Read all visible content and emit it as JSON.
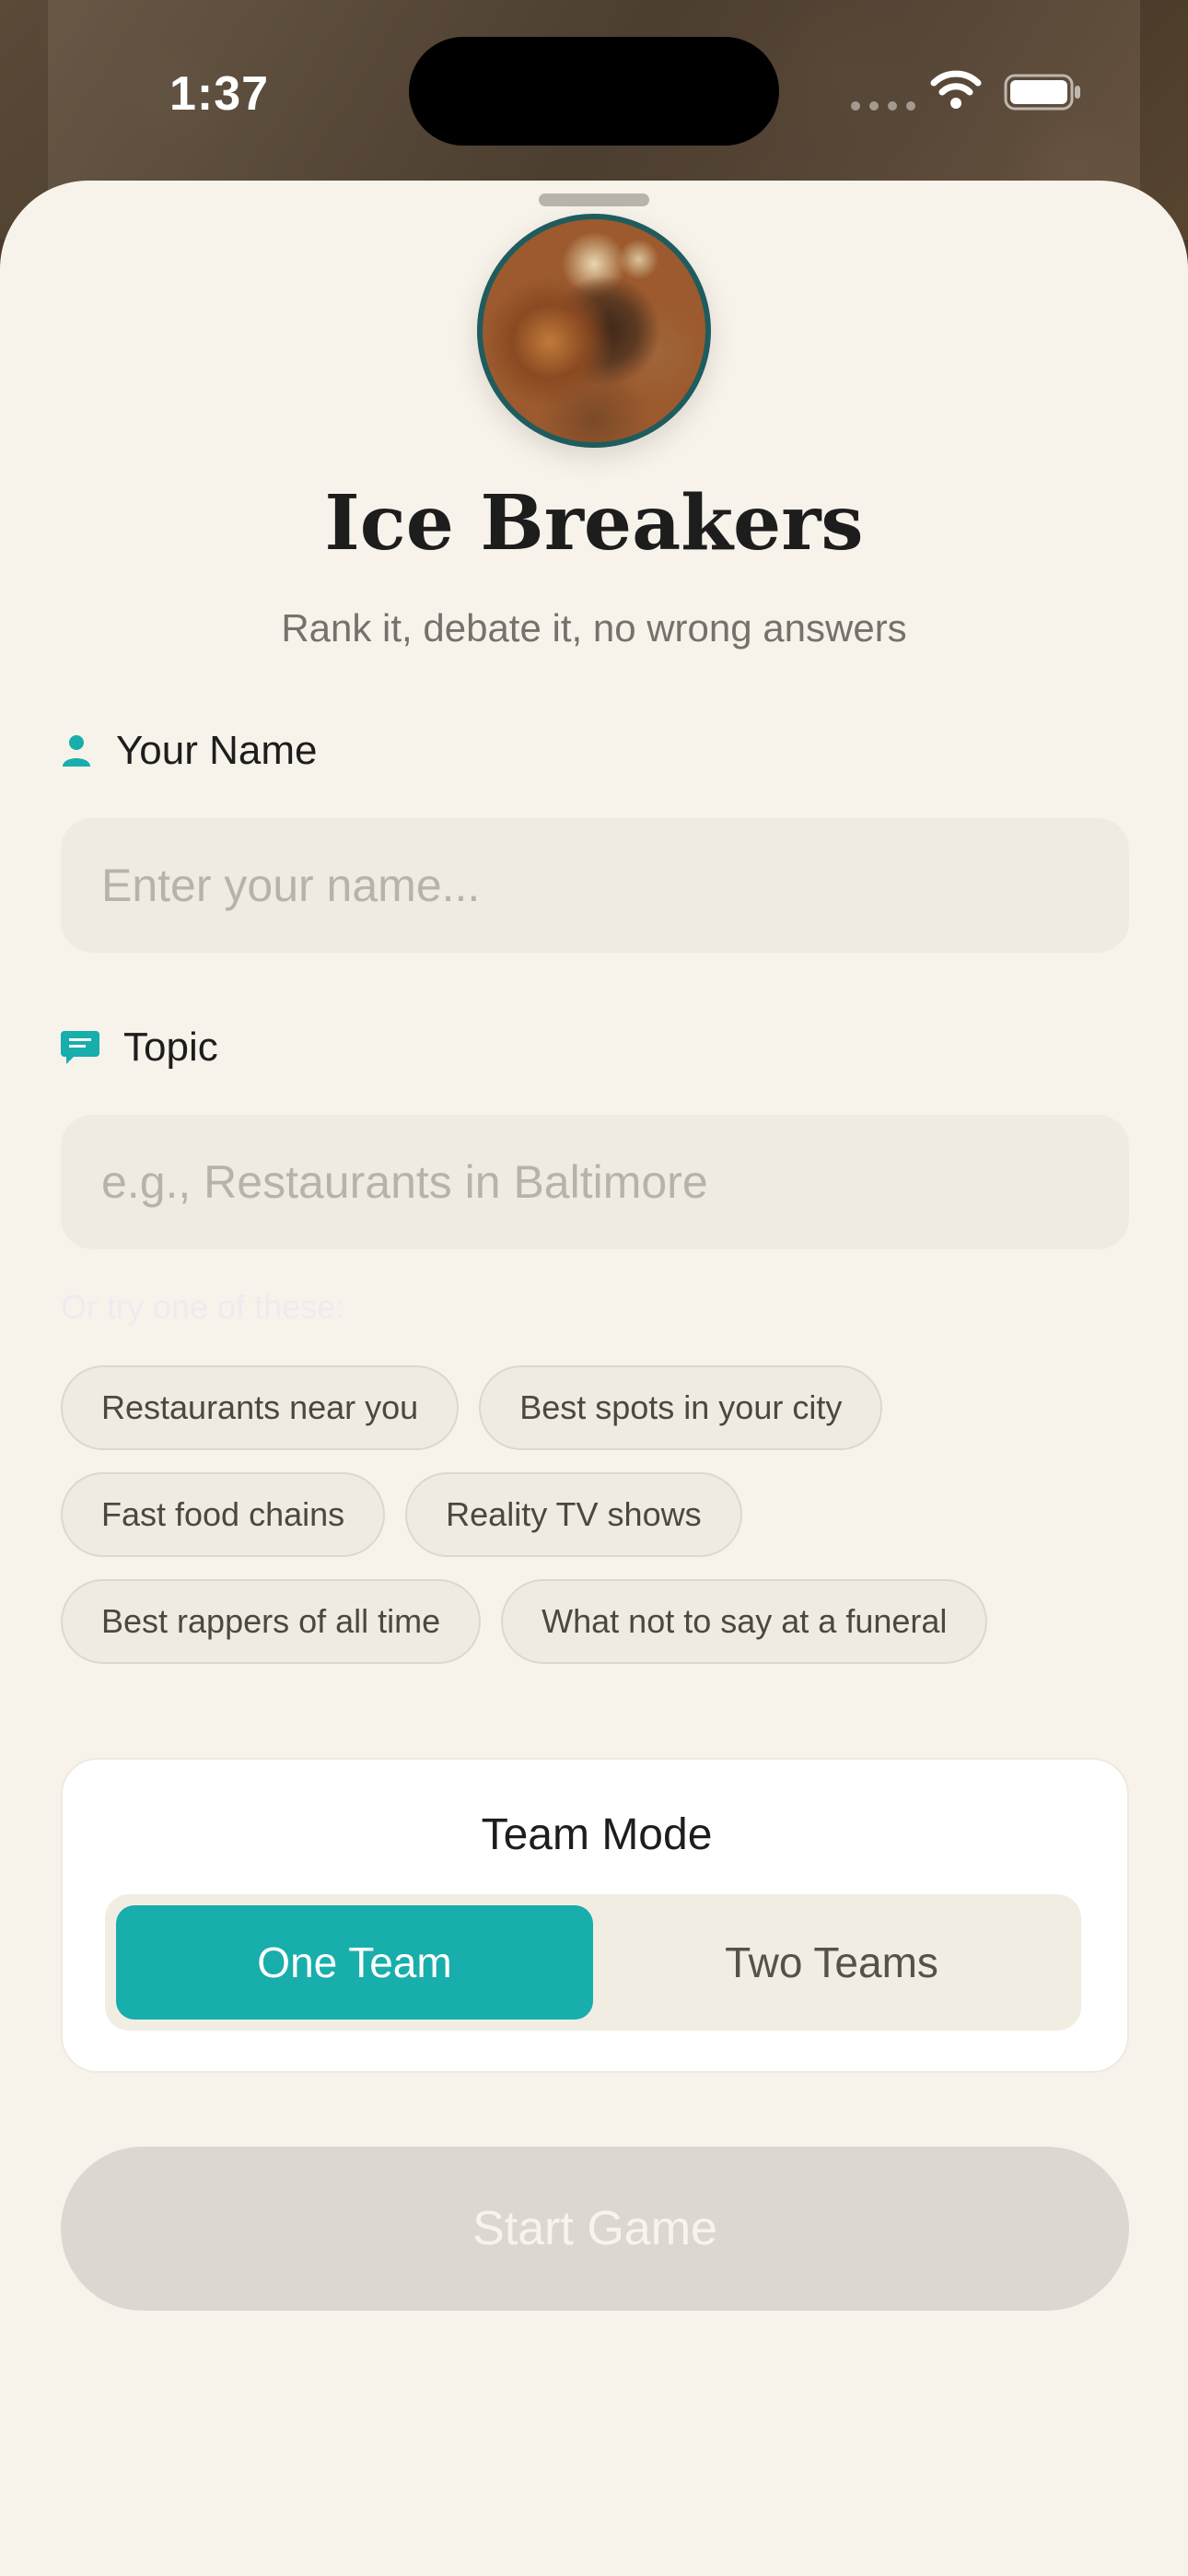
{
  "status_bar": {
    "time": "1:37"
  },
  "header": {
    "title": "Ice Breakers",
    "subtitle": "Rank it, debate it, no wrong answers"
  },
  "name_field": {
    "label": "Your Name",
    "icon": "person-icon",
    "placeholder": "Enter your name...",
    "value": ""
  },
  "topic_field": {
    "label": "Topic",
    "icon": "chat-bubble-icon",
    "placeholder": "e.g., Restaurants in Baltimore",
    "value": "",
    "hint": "Or try one of these:"
  },
  "suggestions": [
    "Restaurants near you",
    "Best spots in your city",
    "Fast food chains",
    "Reality TV shows",
    "Best rappers of all time",
    "What not to say at a funeral"
  ],
  "team_mode": {
    "title": "Team Mode",
    "options": [
      "One Team",
      "Two Teams"
    ],
    "selected": "One Team"
  },
  "start_button": {
    "label": "Start Game",
    "enabled": false
  },
  "colors": {
    "accent": "#17aeac",
    "background": "#f7f3ea",
    "input_bg": "#f0ebe1",
    "disabled_button": "#dcd8d1"
  }
}
